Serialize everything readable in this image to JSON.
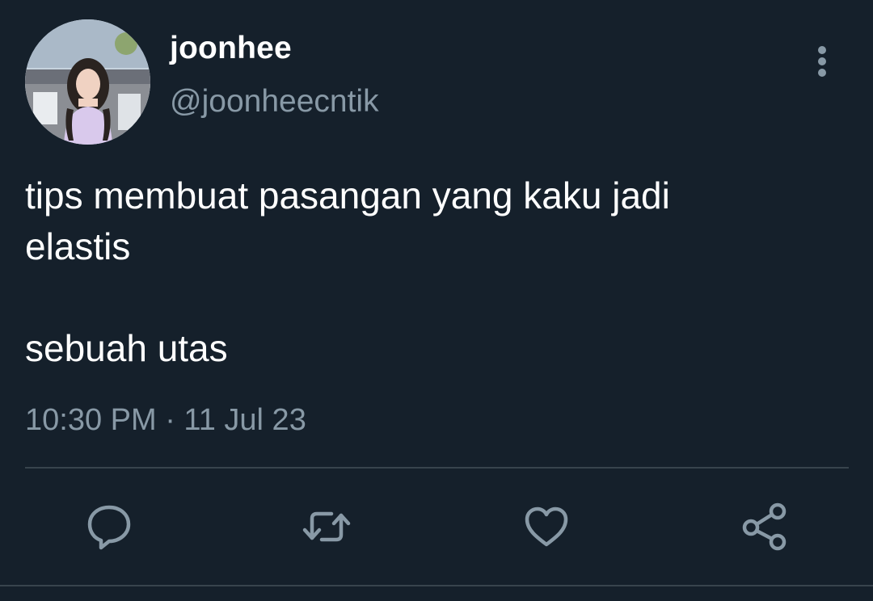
{
  "tweet": {
    "author": {
      "display_name": "joonhee",
      "handle": "@joonheecntik",
      "avatar_icon": "profile-photo"
    },
    "text": "tips membuat pasangan yang kaku jadi\nelastis\n\nsebuah utas",
    "timestamp": "10:30 PM · 11 Jul 23",
    "more_icon": "vertical-ellipsis-icon"
  },
  "actions": [
    {
      "icon": "reply-icon"
    },
    {
      "icon": "retweet-icon"
    },
    {
      "icon": "like-icon"
    },
    {
      "icon": "share-icon"
    }
  ],
  "colors": {
    "background": "#15202b",
    "primary_text": "#ffffff",
    "secondary_text": "#8899a6",
    "divider": "#38444d"
  }
}
